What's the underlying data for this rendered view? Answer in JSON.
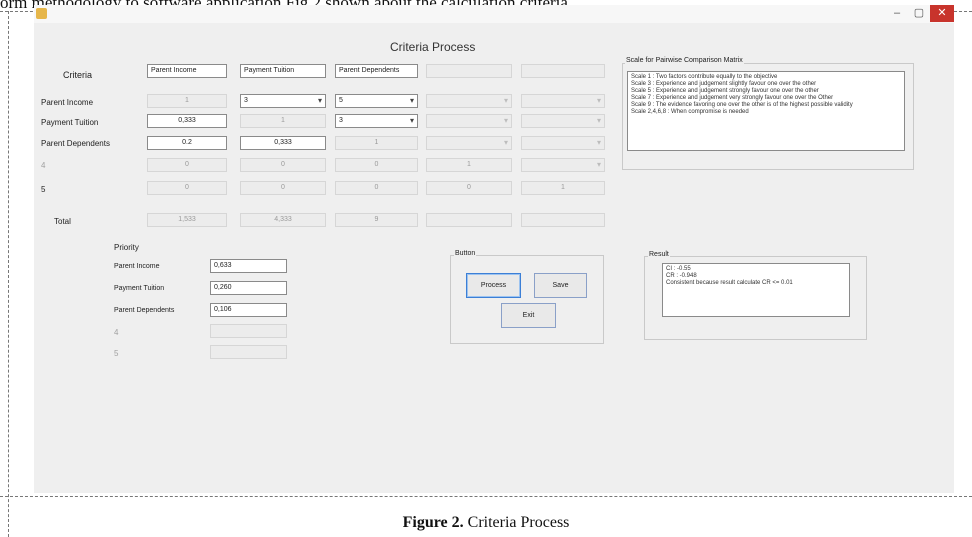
{
  "top_caption": "orm methodology to software application Fig.2 shown about the calculation criteria",
  "window": {
    "title": "Criteria Process",
    "controls": [
      "–",
      "▢",
      "✕"
    ],
    "accent_close": "#c8342c"
  },
  "matrix": {
    "criteria_label": "Criteria",
    "headers": [
      "Parent Income",
      "Payment Tuition",
      "Parent Dependents",
      "",
      ""
    ],
    "rows": [
      {
        "label": "Parent Income",
        "cells": [
          "1",
          "3",
          "5",
          "",
          ""
        ]
      },
      {
        "label": "Payment Tuition",
        "cells": [
          "0,333",
          "1",
          "3",
          "",
          ""
        ]
      },
      {
        "label": "Parent Dependents",
        "cells": [
          "0.2",
          "0,333",
          "1",
          "",
          ""
        ]
      },
      {
        "label": "4",
        "cells": [
          "0",
          "0",
          "0",
          "1",
          ""
        ]
      },
      {
        "label": "5",
        "cells": [
          "0",
          "0",
          "0",
          "0",
          "1"
        ]
      }
    ],
    "total_label": "Total",
    "totals": [
      "1,533",
      "4,333",
      "9",
      "",
      ""
    ]
  },
  "scale": {
    "title": "Scale for Pairwise Comparison Matrix",
    "lines": [
      "Scale 1 : Two factors contribute equally to the objective",
      "Scale 3 : Experience and judgement slightly favour one over the other",
      "Scale 5 : Experience and judgement strongly favour one over the other",
      "Scale 7 : Experience and judgement very strongly favour one over the Other",
      "Scale 9 : The evidence favoring one over the other is of the highest possible validity",
      "Scale 2,4,6,8 : When compromise is needed"
    ]
  },
  "priority": {
    "title": "Priority",
    "rows": [
      {
        "label": "Parent Income",
        "value": "0,633"
      },
      {
        "label": "Payment Tuition",
        "value": "0,260"
      },
      {
        "label": "Parent Dependents",
        "value": "0,106"
      },
      {
        "label": "4",
        "value": ""
      },
      {
        "label": "5",
        "value": ""
      }
    ]
  },
  "buttons": {
    "group_title": "Button",
    "process": "Process",
    "save": "Save",
    "exit": "Exit"
  },
  "result": {
    "title": "Result",
    "lines": [
      "CI : -0.55",
      "CR : -0.948",
      "Consistent because result calculate CR <= 0.01"
    ]
  },
  "figure_caption": {
    "bold": "Figure 2.",
    "text": " Criteria Process"
  }
}
